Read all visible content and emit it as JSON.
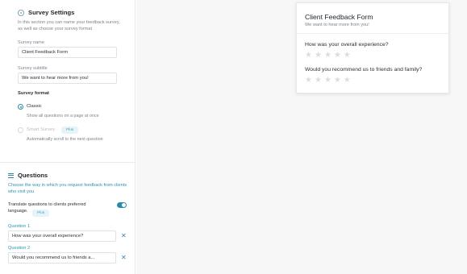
{
  "survey_settings": {
    "title": "Survey Settings",
    "description": "In this section you can name your feedback survey, as well as choose your survey format",
    "name_label": "Survey name",
    "name_value": "Client Feedback Form",
    "subtitle_label": "Survey subtitle",
    "subtitle_value": "We want to hear more from you!",
    "format_label": "Survey format",
    "formats": [
      {
        "title": "Classic",
        "description": "Show all questions on a page at once",
        "selected": true
      },
      {
        "title": "Smart Survey",
        "badge": "Plus",
        "description": "Automatically scroll to the next question",
        "selected": false
      }
    ]
  },
  "questions": {
    "title": "Questions",
    "description": "Choose the way in which you request feedback from clients who visit you",
    "translate_label": "Translate questions to clients preferred language.",
    "translate_badge": "Plus",
    "translate_enabled": true,
    "items": [
      {
        "label": "Question 1",
        "value": "How was your overall experience?"
      },
      {
        "label": "Question 2",
        "value": "Would you recommend us to friends a..."
      }
    ]
  },
  "preview": {
    "title": "Client Feedback Form",
    "subtitle": "We want to hear more from you!",
    "questions": [
      {
        "text": "How was your overall experience?",
        "rating": 0,
        "max": 5
      },
      {
        "text": "Would you recommend us to friends and family?",
        "rating": 0,
        "max": 5
      }
    ]
  },
  "colors": {
    "accent": "#2b8aa8",
    "text": "#2b3035",
    "muted": "#7d858c",
    "badge_bg": "#e6f3f8"
  },
  "icons": {
    "settings": "gear-icon",
    "questions": "list-icon",
    "remove": "close-icon",
    "rating": "star-icon"
  }
}
